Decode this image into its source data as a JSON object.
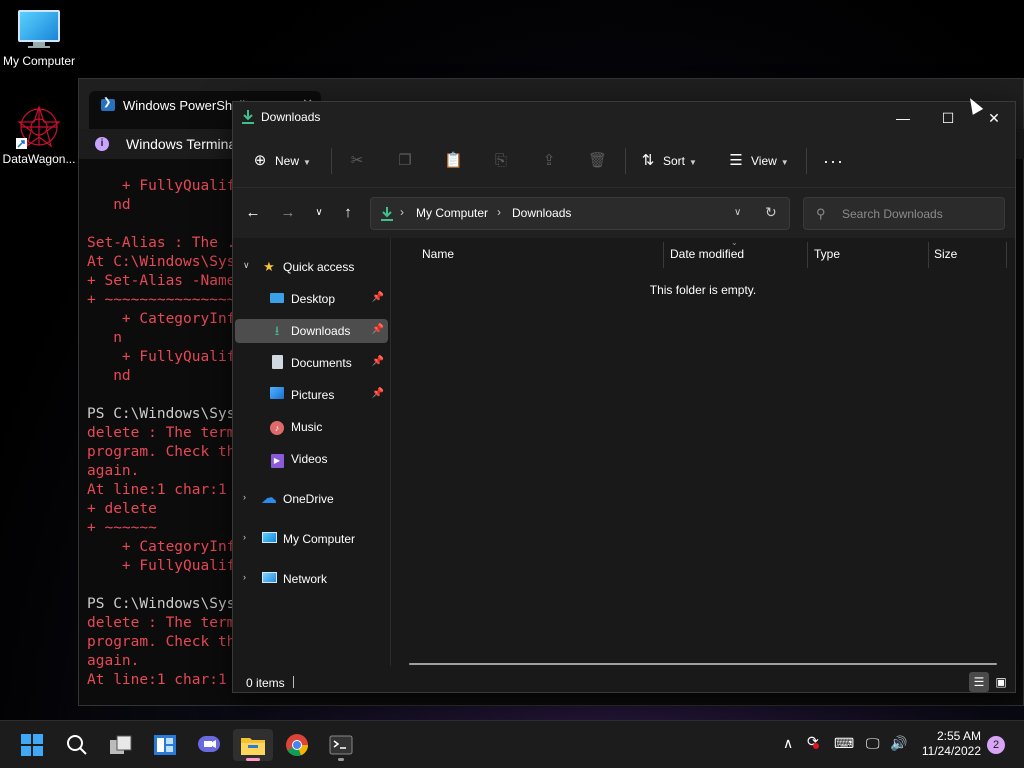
{
  "desktop": {
    "icons": [
      {
        "label": "My Computer"
      },
      {
        "label": "DataWagon..."
      }
    ]
  },
  "terminal": {
    "tab_title": "Windows PowerShell",
    "info_title": "Windows Terminal",
    "lines": [
      {
        "text": "    + FullyQualifiedErrorId : CommandNotFoundException",
        "color": "red"
      },
      {
        "text": "   nd",
        "color": "red"
      },
      {
        "text": "",
        "color": "red"
      },
      {
        "text": "Set-Alias : The ...",
        "color": "red"
      },
      {
        "text": "At C:\\Windows\\Sys...",
        "color": "red"
      },
      {
        "text": "+ Set-Alias -Name...",
        "color": "red"
      },
      {
        "text": "+ ~~~~~~~~~~~~~~~~",
        "color": "red"
      },
      {
        "text": "    + CategoryInfo",
        "color": "red"
      },
      {
        "text": "   n",
        "color": "red"
      },
      {
        "text": "    + FullyQualif...",
        "color": "red"
      },
      {
        "text": "   nd",
        "color": "red"
      },
      {
        "text": "",
        "color": "red"
      },
      {
        "text": "PS C:\\Windows\\Sys...",
        "color": "white"
      },
      {
        "text": "delete : The term...",
        "color": "red"
      },
      {
        "text": "program. Check th...",
        "color": "red"
      },
      {
        "text": "again.",
        "color": "red"
      },
      {
        "text": "At line:1 char:1",
        "color": "red"
      },
      {
        "text": "+ delete",
        "color": "red"
      },
      {
        "text": "+ ~~~~~~",
        "color": "red"
      },
      {
        "text": "    + CategoryInfo",
        "color": "red"
      },
      {
        "text": "    + FullyQualif...",
        "color": "red"
      },
      {
        "text": "",
        "color": "red"
      },
      {
        "text": "PS C:\\Windows\\Sys...",
        "color": "white"
      },
      {
        "text": "delete : The term...",
        "color": "red"
      },
      {
        "text": "program. Check th...",
        "color": "red"
      },
      {
        "text": "again.",
        "color": "red"
      },
      {
        "text": "At line:1 char:1",
        "color": "red"
      }
    ]
  },
  "explorer": {
    "title": "Downloads",
    "commands": {
      "new": "New",
      "sort": "Sort",
      "view": "View"
    },
    "breadcrumb": [
      "My Computer",
      "Downloads"
    ],
    "search_placeholder": "Search Downloads",
    "sidebar": {
      "quick_access": "Quick access",
      "pinned": [
        {
          "label": "Desktop",
          "icon": "desktop-icon",
          "pinned": true
        },
        {
          "label": "Downloads",
          "icon": "downloads-icon",
          "pinned": true,
          "selected": true
        },
        {
          "label": "Documents",
          "icon": "documents-icon",
          "pinned": true
        },
        {
          "label": "Pictures",
          "icon": "pictures-icon",
          "pinned": true
        },
        {
          "label": "Music",
          "icon": "music-icon",
          "pinned": false
        },
        {
          "label": "Videos",
          "icon": "videos-icon",
          "pinned": false
        }
      ],
      "roots": [
        {
          "label": "OneDrive",
          "icon": "onedrive-icon"
        },
        {
          "label": "My Computer",
          "icon": "computer-icon"
        },
        {
          "label": "Network",
          "icon": "network-icon"
        }
      ]
    },
    "columns": [
      "Name",
      "Date modified",
      "Type",
      "Size"
    ],
    "empty_message": "This folder is empty.",
    "status": {
      "item_count": "0 items"
    }
  },
  "taskbar": {
    "clock_time": "2:55 AM",
    "clock_date": "11/24/2022",
    "notification_count": "2"
  },
  "colors": {
    "accent_pink": "#ff9ac2",
    "terminal_error": "#e74856",
    "selected_item": "#4d4d4d"
  }
}
